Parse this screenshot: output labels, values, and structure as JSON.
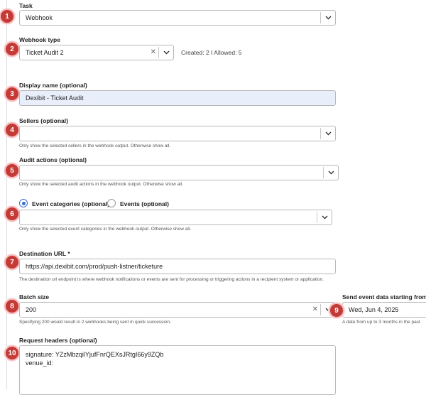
{
  "task": {
    "label": "Task",
    "value": "Webhook",
    "badge": "1"
  },
  "webhook_type": {
    "label": "Webhook type",
    "value": "Ticket Audit 2",
    "badge": "2",
    "created_text": "Created: 2  I  Allowed: 5"
  },
  "display_name": {
    "label": "Display name (optional)",
    "value": "Dexibit - Ticket Audit",
    "badge": "3"
  },
  "sellers": {
    "label": "Sellers (optional)",
    "value": "",
    "badge": "4",
    "help": "Only show the selected sellers in the webhook output. Otherwise show all."
  },
  "audit_actions": {
    "label": "Audit actions (optional)",
    "value": "",
    "badge": "5",
    "help": "Only show the selected audit actions in the webhook output. Otherwise show all."
  },
  "event_filter": {
    "badge": "6",
    "radio_categories": "Event categories (optional)",
    "radio_events": "Events (optional)",
    "selected": "categories",
    "value": "",
    "help": "Only show the selected event categories in the webhook output. Otherwise show all."
  },
  "destination_url": {
    "label": "Destination URL *",
    "value": "https://api.dexibit.com/prod/push-listner/ticketure",
    "badge": "7",
    "help": "The destination url endpoint is where webhook notifications or events are sent for processing or triggering actions in a recipient system or application."
  },
  "batch_size": {
    "label": "Batch size",
    "value": "200",
    "badge": "8",
    "help": "Specifying 200 would result in 2 webhooks being sent in quick succession."
  },
  "send_start": {
    "label": "Send event data starting from *",
    "value": "Wed, Jun 4, 2025",
    "badge": "9",
    "help": "A date from up to 3 months in the past"
  },
  "request_headers": {
    "label": "Request headers (optional)",
    "badge": "10",
    "lines": [
      "signature: YZzMbzqilYjufFnrQEXsJRtgI66y9ZQb",
      "venue_id:"
    ]
  },
  "colors": {
    "badge": "#c43a35",
    "radio_active": "#3b6fd3",
    "filled_field": "#e8effb"
  }
}
